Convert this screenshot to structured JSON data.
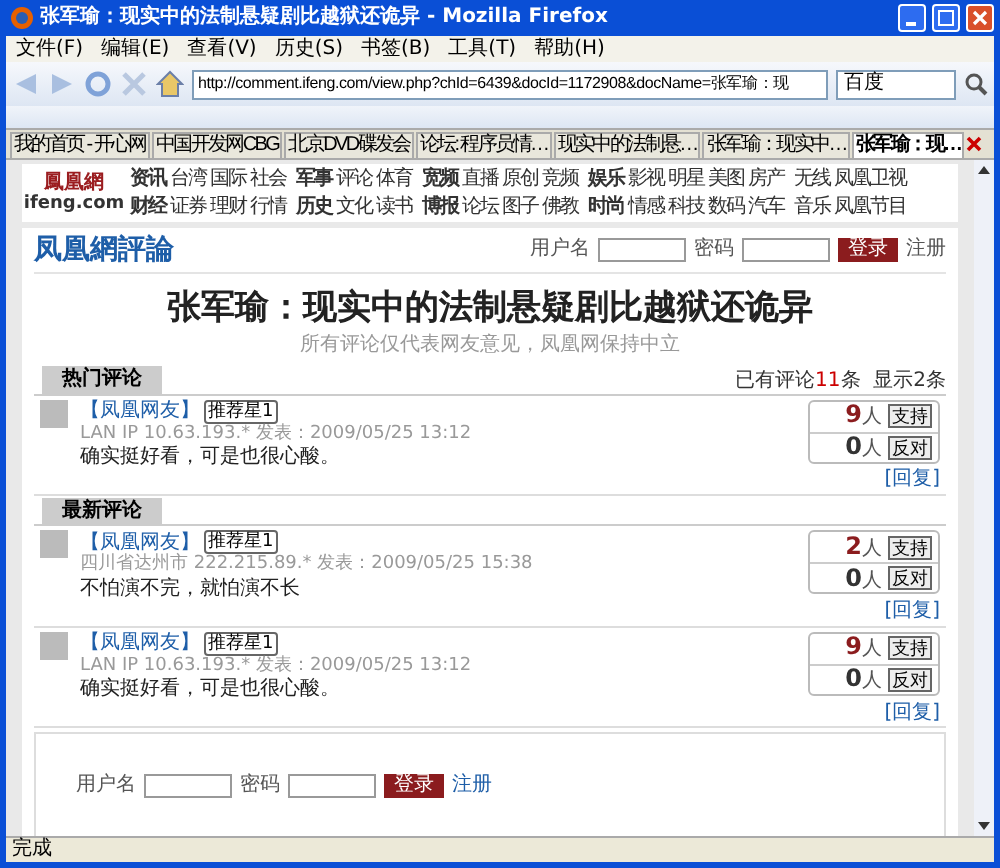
{
  "window": {
    "title": "张军瑜：现实中的法制悬疑剧比越狱还诡异 - Mozilla Firefox"
  },
  "menu": [
    "文件(F)",
    "编辑(E)",
    "查看(V)",
    "历史(S)",
    "书签(B)",
    "工具(T)",
    "帮助(H)"
  ],
  "toolbar": {
    "address": "http://comment.ifeng.com/view.php?chId=6439&docId=1172908&docName=张军瑜：现",
    "search": "百度"
  },
  "tabs": [
    {
      "label": "我的首页 - 开心网",
      "selected": false
    },
    {
      "label": "中国开发网CBG",
      "selected": false
    },
    {
      "label": "北京DVD碟发会",
      "selected": false
    },
    {
      "label": "论坛: 程序员情…",
      "selected": false
    },
    {
      "label": "现实中的法制悬…",
      "selected": false
    },
    {
      "label": "张军瑜：现实中…",
      "selected": false
    },
    {
      "label": "张军瑜：现…",
      "selected": true
    }
  ],
  "site": {
    "logo": "鳳凰網",
    "domain": "ifeng.com"
  },
  "nav": [
    [
      {
        "label": "资讯",
        "bold": true
      },
      {
        "label": "台湾",
        "bold": false
      },
      {
        "label": "国际",
        "bold": false
      },
      {
        "label": "社会",
        "bold": false
      },
      {
        "label": "财经",
        "bold": true
      },
      {
        "label": "证券",
        "bold": false
      },
      {
        "label": "理财",
        "bold": false
      },
      {
        "label": "行情",
        "bold": false
      }
    ],
    [
      {
        "label": "军事",
        "bold": true
      },
      {
        "label": "评论",
        "bold": false
      },
      {
        "label": "体育",
        "bold": false
      },
      {
        "label": "历史",
        "bold": true
      },
      {
        "label": "文化",
        "bold": false
      },
      {
        "label": "读书",
        "bold": false
      }
    ],
    [
      {
        "label": "宽频",
        "bold": true
      },
      {
        "label": "直播",
        "bold": false
      },
      {
        "label": "原创",
        "bold": false
      },
      {
        "label": "竞频",
        "bold": false
      },
      {
        "label": "博报",
        "bold": true
      },
      {
        "label": "论坛",
        "bold": false
      },
      {
        "label": "图子",
        "bold": false
      },
      {
        "label": "佛教",
        "bold": false
      }
    ],
    [
      {
        "label": "娱乐",
        "bold": true
      },
      {
        "label": "影视",
        "bold": false
      },
      {
        "label": "明星",
        "bold": false
      },
      {
        "label": "美图",
        "bold": false
      },
      {
        "label": "房产",
        "bold": false
      },
      {
        "label": "时尚",
        "bold": true
      },
      {
        "label": "情感",
        "bold": false
      },
      {
        "label": "科技",
        "bold": false
      },
      {
        "label": "数码",
        "bold": false
      },
      {
        "label": "汽车",
        "bold": false
      }
    ],
    [
      {
        "label": "无线",
        "bold": false
      },
      {
        "label": "凤凰卫视",
        "bold": false
      },
      {
        "label": "音乐",
        "bold": false
      },
      {
        "label": "凤凰节目",
        "bold": false
      }
    ]
  ],
  "brand": "凤凰網評論",
  "login": {
    "user_label": "用户名",
    "pass_label": "密码",
    "button": "登录",
    "register": "注册"
  },
  "article": {
    "title": "张军瑜：现实中的法制悬疑剧比越狱还诡异",
    "subtitle": "所有评论仅代表网友意见，凤凰网保持中立"
  },
  "sections": [
    {
      "tab": "热门评论",
      "summary": {
        "before": "已有评论",
        "count": "11",
        "after": "条  显示2条"
      },
      "comments": [
        {
          "user": "【凤凰网友】",
          "badge": "推荐星1",
          "meta": "LAN IP 10.63.193.* 发表：2009/05/25 13:12",
          "text": "确实挺好看，可是也很心酸。",
          "support": "9",
          "unit": "人",
          "support_button": "支持",
          "oppose": "0",
          "oppose_unit": "人",
          "oppose_button": "反对",
          "reply": "[回复]"
        }
      ]
    },
    {
      "tab": "最新评论",
      "comments": [
        {
          "user": "【凤凰网友】",
          "badge": "推荐星1",
          "meta": "四川省达州市 222.215.89.* 发表：2009/05/25 15:38",
          "text": "不怕演不完，就怕演不长",
          "support": "2",
          "unit": "人",
          "support_button": "支持",
          "oppose": "0",
          "oppose_unit": "人",
          "oppose_button": "反对",
          "reply": "[回复]"
        },
        {
          "user": "【凤凰网友】",
          "badge": "推荐星1",
          "meta": "LAN IP 10.63.193.* 发表：2009/05/25 13:12",
          "text": "确实挺好看，可是也很心酸。",
          "support": "9",
          "unit": "人",
          "support_button": "支持",
          "oppose": "0",
          "oppose_unit": "人",
          "oppose_button": "反对",
          "reply": "[回复]"
        }
      ]
    }
  ],
  "bottom_login": {
    "user_label": "用户名",
    "pass_label": "密码",
    "button": "登录",
    "register": "注册"
  },
  "status_bar": "完成"
}
